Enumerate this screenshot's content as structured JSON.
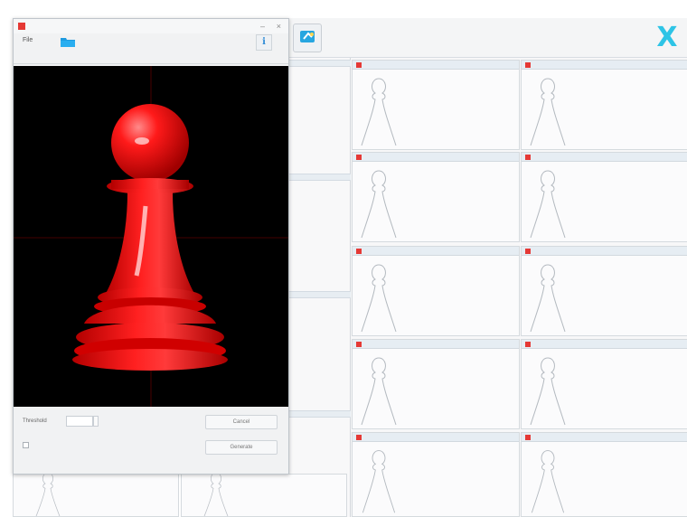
{
  "app": {
    "toolbar": {
      "icon_caption": "",
      "close_glyph": "X"
    },
    "accent_color": "#2ec4e6",
    "brand_color": "#e53935"
  },
  "dialog": {
    "title": "",
    "menu": {
      "file": "File",
      "info_glyph": "i"
    },
    "path": "",
    "threshold_label": "Threshold",
    "threshold_value": "",
    "cancel_label": "Cancel",
    "generate_label": "Generate",
    "checkbox_label": "",
    "checkbox_checked": false
  },
  "bottom_label": "",
  "grid": {
    "left_strips": [
      {
        "num": ""
      },
      {
        "num": ""
      },
      {
        "num": ""
      },
      {
        "num": ""
      }
    ],
    "cards": [
      {
        "caption": "",
        "count": ""
      },
      {
        "caption": "",
        "count": ""
      },
      {
        "caption": "",
        "count": ""
      },
      {
        "caption": "",
        "count": ""
      },
      {
        "caption": "",
        "count": ""
      },
      {
        "caption": "",
        "count": ""
      },
      {
        "caption": "",
        "count": ""
      },
      {
        "caption": "",
        "count": ""
      },
      {
        "caption": "",
        "count": ""
      },
      {
        "caption": "",
        "count": ""
      }
    ]
  }
}
